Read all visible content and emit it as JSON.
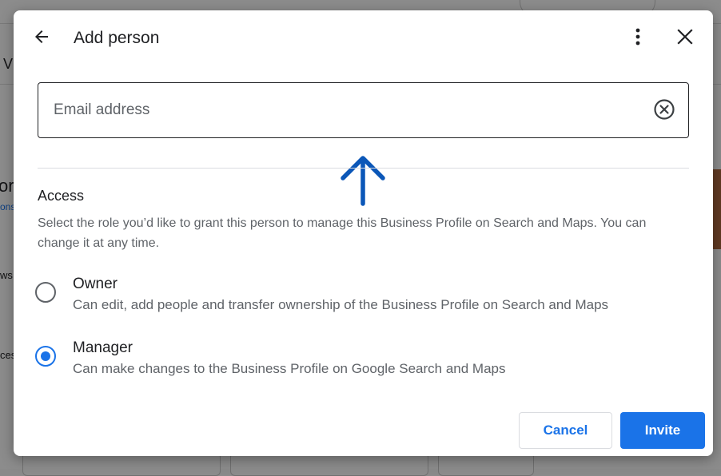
{
  "background": {
    "fragments": [
      "V",
      "or",
      "ons",
      "ws",
      "ces"
    ]
  },
  "dialog": {
    "title": "Add person",
    "email": {
      "placeholder": "Email address",
      "value": ""
    },
    "access": {
      "heading": "Access",
      "description": "Select the role you’d like to grant this person to manage this Business Profile on Search and Maps. You can change it at any time."
    },
    "roles": [
      {
        "name": "Owner",
        "description": "Can edit, add people and transfer ownership of the Business Profile on Search and Maps",
        "selected": false
      },
      {
        "name": "Manager",
        "description": "Can make changes to the Business Profile on Google Search and Maps",
        "selected": true
      }
    ],
    "buttons": {
      "cancel": "Cancel",
      "invite": "Invite"
    }
  },
  "colors": {
    "accent": "#1a73e8",
    "annotation": "#0b57b8",
    "text_primary": "#202124",
    "text_secondary": "#5f6368"
  },
  "icons": {
    "back": "arrow-back-icon",
    "more": "more-vert-icon",
    "close": "close-icon",
    "clear": "clear-circle-icon",
    "annotation": "up-arrow-icon"
  }
}
